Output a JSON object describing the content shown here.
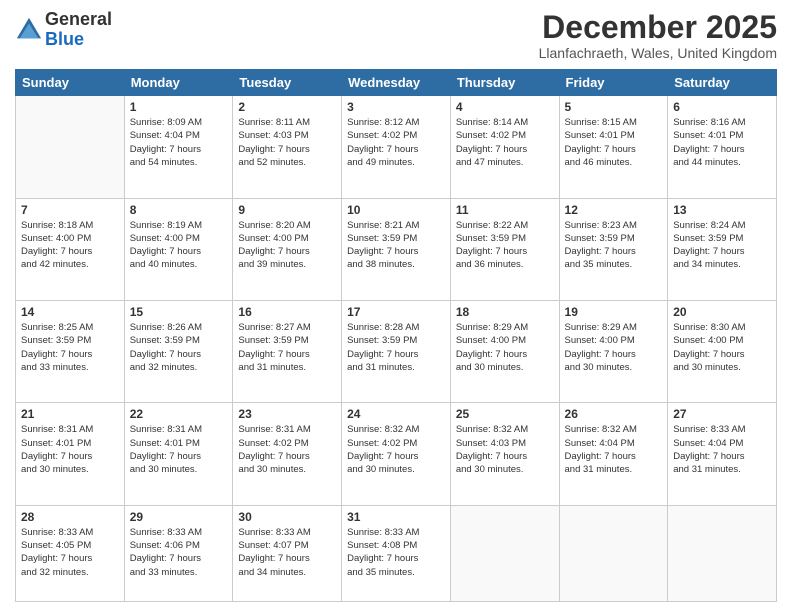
{
  "logo": {
    "general": "General",
    "blue": "Blue"
  },
  "header": {
    "month_year": "December 2025",
    "location": "Llanfachraeth, Wales, United Kingdom"
  },
  "days_of_week": [
    "Sunday",
    "Monday",
    "Tuesday",
    "Wednesday",
    "Thursday",
    "Friday",
    "Saturday"
  ],
  "weeks": [
    [
      {
        "day": "",
        "info": ""
      },
      {
        "day": "1",
        "info": "Sunrise: 8:09 AM\nSunset: 4:04 PM\nDaylight: 7 hours\nand 54 minutes."
      },
      {
        "day": "2",
        "info": "Sunrise: 8:11 AM\nSunset: 4:03 PM\nDaylight: 7 hours\nand 52 minutes."
      },
      {
        "day": "3",
        "info": "Sunrise: 8:12 AM\nSunset: 4:02 PM\nDaylight: 7 hours\nand 49 minutes."
      },
      {
        "day": "4",
        "info": "Sunrise: 8:14 AM\nSunset: 4:02 PM\nDaylight: 7 hours\nand 47 minutes."
      },
      {
        "day": "5",
        "info": "Sunrise: 8:15 AM\nSunset: 4:01 PM\nDaylight: 7 hours\nand 46 minutes."
      },
      {
        "day": "6",
        "info": "Sunrise: 8:16 AM\nSunset: 4:01 PM\nDaylight: 7 hours\nand 44 minutes."
      }
    ],
    [
      {
        "day": "7",
        "info": "Sunrise: 8:18 AM\nSunset: 4:00 PM\nDaylight: 7 hours\nand 42 minutes."
      },
      {
        "day": "8",
        "info": "Sunrise: 8:19 AM\nSunset: 4:00 PM\nDaylight: 7 hours\nand 40 minutes."
      },
      {
        "day": "9",
        "info": "Sunrise: 8:20 AM\nSunset: 4:00 PM\nDaylight: 7 hours\nand 39 minutes."
      },
      {
        "day": "10",
        "info": "Sunrise: 8:21 AM\nSunset: 3:59 PM\nDaylight: 7 hours\nand 38 minutes."
      },
      {
        "day": "11",
        "info": "Sunrise: 8:22 AM\nSunset: 3:59 PM\nDaylight: 7 hours\nand 36 minutes."
      },
      {
        "day": "12",
        "info": "Sunrise: 8:23 AM\nSunset: 3:59 PM\nDaylight: 7 hours\nand 35 minutes."
      },
      {
        "day": "13",
        "info": "Sunrise: 8:24 AM\nSunset: 3:59 PM\nDaylight: 7 hours\nand 34 minutes."
      }
    ],
    [
      {
        "day": "14",
        "info": "Sunrise: 8:25 AM\nSunset: 3:59 PM\nDaylight: 7 hours\nand 33 minutes."
      },
      {
        "day": "15",
        "info": "Sunrise: 8:26 AM\nSunset: 3:59 PM\nDaylight: 7 hours\nand 32 minutes."
      },
      {
        "day": "16",
        "info": "Sunrise: 8:27 AM\nSunset: 3:59 PM\nDaylight: 7 hours\nand 31 minutes."
      },
      {
        "day": "17",
        "info": "Sunrise: 8:28 AM\nSunset: 3:59 PM\nDaylight: 7 hours\nand 31 minutes."
      },
      {
        "day": "18",
        "info": "Sunrise: 8:29 AM\nSunset: 4:00 PM\nDaylight: 7 hours\nand 30 minutes."
      },
      {
        "day": "19",
        "info": "Sunrise: 8:29 AM\nSunset: 4:00 PM\nDaylight: 7 hours\nand 30 minutes."
      },
      {
        "day": "20",
        "info": "Sunrise: 8:30 AM\nSunset: 4:00 PM\nDaylight: 7 hours\nand 30 minutes."
      }
    ],
    [
      {
        "day": "21",
        "info": "Sunrise: 8:31 AM\nSunset: 4:01 PM\nDaylight: 7 hours\nand 30 minutes."
      },
      {
        "day": "22",
        "info": "Sunrise: 8:31 AM\nSunset: 4:01 PM\nDaylight: 7 hours\nand 30 minutes."
      },
      {
        "day": "23",
        "info": "Sunrise: 8:31 AM\nSunset: 4:02 PM\nDaylight: 7 hours\nand 30 minutes."
      },
      {
        "day": "24",
        "info": "Sunrise: 8:32 AM\nSunset: 4:02 PM\nDaylight: 7 hours\nand 30 minutes."
      },
      {
        "day": "25",
        "info": "Sunrise: 8:32 AM\nSunset: 4:03 PM\nDaylight: 7 hours\nand 30 minutes."
      },
      {
        "day": "26",
        "info": "Sunrise: 8:32 AM\nSunset: 4:04 PM\nDaylight: 7 hours\nand 31 minutes."
      },
      {
        "day": "27",
        "info": "Sunrise: 8:33 AM\nSunset: 4:04 PM\nDaylight: 7 hours\nand 31 minutes."
      }
    ],
    [
      {
        "day": "28",
        "info": "Sunrise: 8:33 AM\nSunset: 4:05 PM\nDaylight: 7 hours\nand 32 minutes."
      },
      {
        "day": "29",
        "info": "Sunrise: 8:33 AM\nSunset: 4:06 PM\nDaylight: 7 hours\nand 33 minutes."
      },
      {
        "day": "30",
        "info": "Sunrise: 8:33 AM\nSunset: 4:07 PM\nDaylight: 7 hours\nand 34 minutes."
      },
      {
        "day": "31",
        "info": "Sunrise: 8:33 AM\nSunset: 4:08 PM\nDaylight: 7 hours\nand 35 minutes."
      },
      {
        "day": "",
        "info": ""
      },
      {
        "day": "",
        "info": ""
      },
      {
        "day": "",
        "info": ""
      }
    ]
  ]
}
